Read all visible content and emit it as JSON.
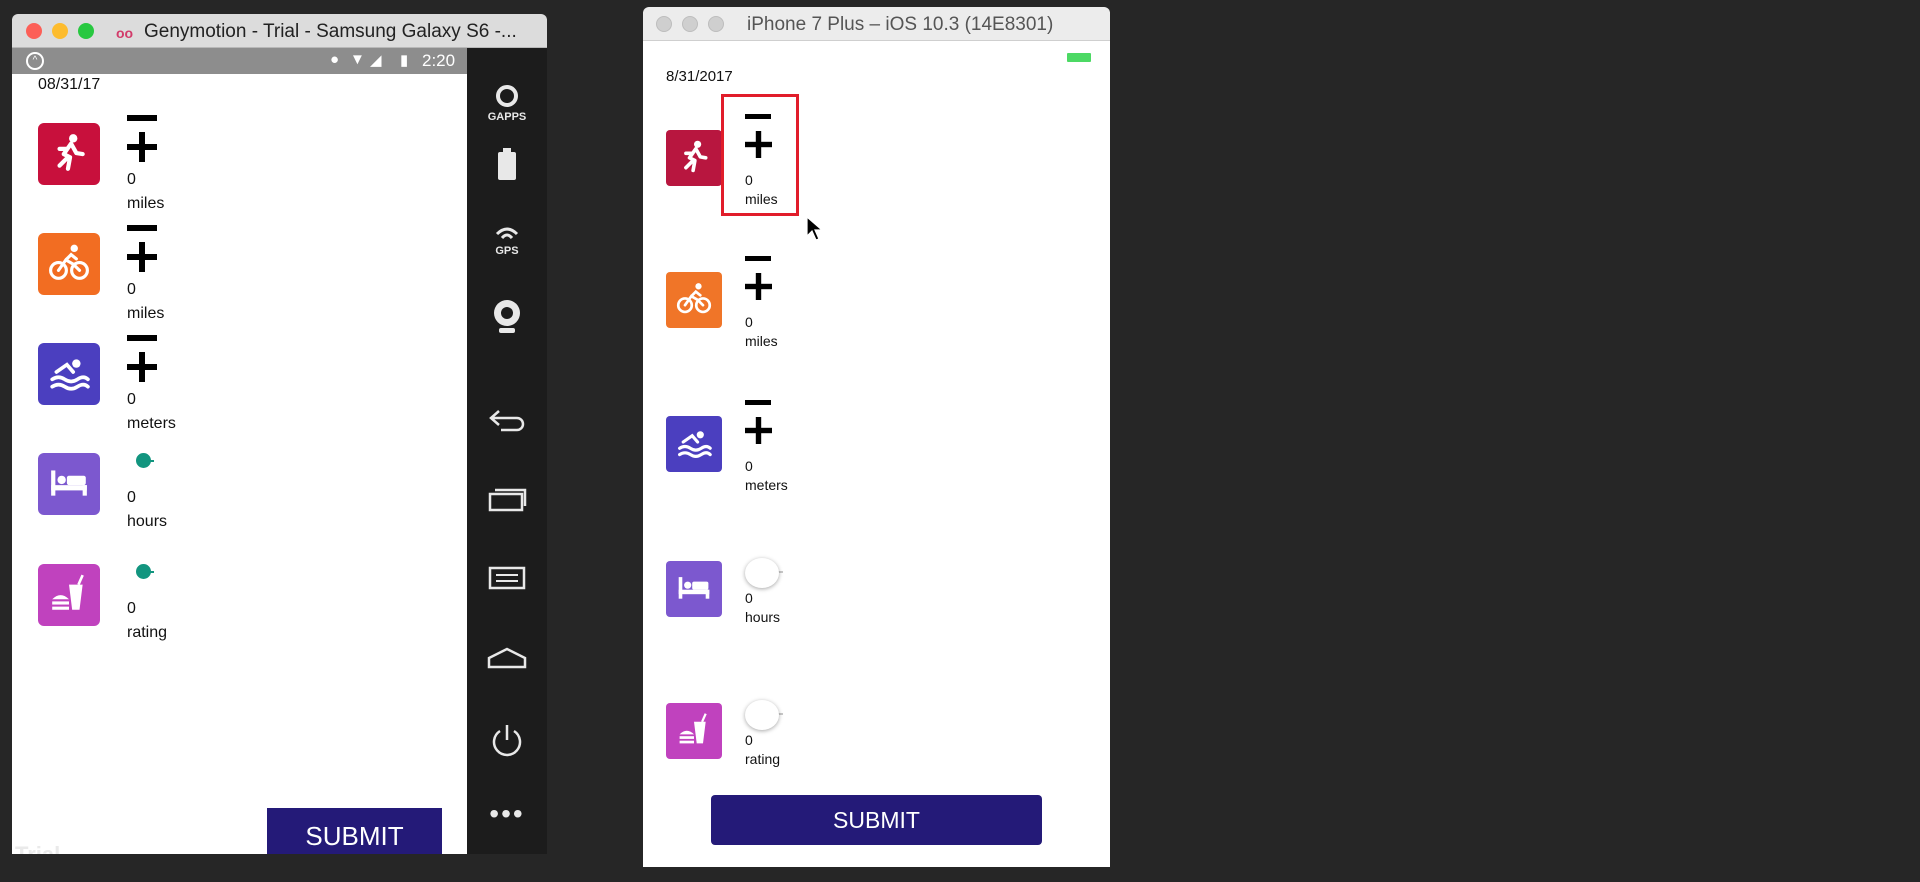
{
  "genymotion": {
    "window_title": "Genymotion - Trial - Samsung Galaxy S6 -...",
    "status_time": "2:20",
    "app_date": "08/31/17",
    "sidebar": [
      {
        "icon": "gapps-icon",
        "caption": "GAPPS"
      },
      {
        "icon": "battery-icon",
        "caption": ""
      },
      {
        "icon": "gps-icon",
        "caption": "GPS"
      },
      {
        "icon": "webcam-icon",
        "caption": ""
      },
      {
        "icon": "back-icon",
        "caption": ""
      },
      {
        "icon": "recent-apps-icon",
        "caption": ""
      },
      {
        "icon": "menu-icon",
        "caption": ""
      },
      {
        "icon": "home-icon",
        "caption": ""
      },
      {
        "icon": "power-icon",
        "caption": ""
      },
      {
        "icon": "more-icon",
        "caption": "•••"
      }
    ],
    "activities": [
      {
        "icon": "running-icon",
        "color": "#c8103c",
        "value": "0",
        "unit": "miles",
        "control": "stepper"
      },
      {
        "icon": "cycling-icon",
        "color": "#f26d22",
        "value": "0",
        "unit": "miles",
        "control": "stepper"
      },
      {
        "icon": "swimming-icon",
        "color": "#4b3fbf",
        "value": "0",
        "unit": "meters",
        "control": "stepper"
      },
      {
        "icon": "sleep-icon",
        "color": "#7c58cf",
        "value": "0",
        "unit": "hours",
        "control": "slider",
        "slider_level": 0
      },
      {
        "icon": "food-icon",
        "color": "#c042be",
        "value": "0",
        "unit": "rating",
        "control": "slider",
        "slider_level": 0
      }
    ],
    "submit_label": "SUBMIT",
    "watermark": "Trial"
  },
  "ios": {
    "window_title": "iPhone 7 Plus – iOS 10.3 (14E8301)",
    "app_date": "8/31/2017",
    "activities": [
      {
        "icon": "running-icon",
        "color": "#b8163f",
        "value": "0",
        "unit": "miles",
        "control": "stepper"
      },
      {
        "icon": "cycling-icon",
        "color": "#f07528",
        "value": "0",
        "unit": "miles",
        "control": "stepper"
      },
      {
        "icon": "swimming-icon",
        "color": "#4b3fbf",
        "value": "0",
        "unit": "meters",
        "control": "stepper"
      },
      {
        "icon": "sleep-icon",
        "color": "#7c58cf",
        "value": "0",
        "unit": "hours",
        "control": "slider",
        "slider_level": 0
      },
      {
        "icon": "food-icon",
        "color": "#c042be",
        "value": "0",
        "unit": "rating",
        "control": "slider",
        "slider_level": 0
      }
    ],
    "submit_label": "SUBMIT"
  },
  "colors": {
    "desktop_bg": "#262626",
    "submit_bg": "#241a78",
    "slider_accent": "#12957f",
    "highlight": "#e11d2a"
  }
}
